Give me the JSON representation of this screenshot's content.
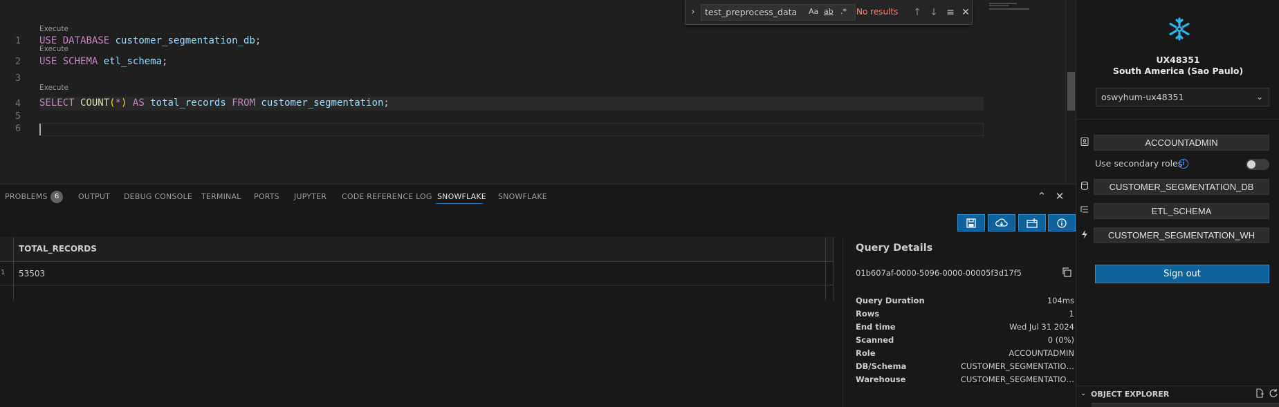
{
  "editor": {
    "codelens_label": "Execute",
    "line_numbers": [
      "1",
      "2",
      "3",
      "4",
      "5",
      "6"
    ],
    "lines": {
      "l1": {
        "kw1": "USE",
        "kw2": "DATABASE",
        "ident": "customer_segmentation_db",
        "term": ";"
      },
      "l2": {
        "kw1": "USE",
        "kw2": "SCHEMA",
        "ident": "etl_schema",
        "term": ";"
      },
      "l4": {
        "kw1": "SELECT",
        "fn": "COUNT",
        "open": "(",
        "star": "*",
        "close": ")",
        "kw2": "AS",
        "alias": "total_records",
        "kw3": "FROM",
        "table": "customer_segmentation",
        "term": ";"
      }
    }
  },
  "find_widget": {
    "query": "test_preprocess_data",
    "match_case": "Aa",
    "whole_word": "ab",
    "regex": ".*",
    "status": "No results"
  },
  "panel": {
    "tabs": [
      {
        "label": "PROBLEMS",
        "badge": "6"
      },
      {
        "label": "OUTPUT"
      },
      {
        "label": "DEBUG CONSOLE"
      },
      {
        "label": "TERMINAL"
      },
      {
        "label": "PORTS"
      },
      {
        "label": "JUPYTER"
      },
      {
        "label": "CODE REFERENCE LOG"
      },
      {
        "label": "SNOWFLAKE",
        "active": true
      },
      {
        "label": "SNOWFLAKE"
      }
    ]
  },
  "results": {
    "columns": [
      "TOTAL_RECORDS"
    ],
    "rows": [
      {
        "num": "1",
        "values": [
          "53503"
        ]
      }
    ]
  },
  "query_details": {
    "title": "Query Details",
    "query_id": "01b607af-0000-5096-0000-00005f3d17f5",
    "fields": [
      {
        "key": "Query Duration",
        "value": "104ms"
      },
      {
        "key": "Rows",
        "value": "1"
      },
      {
        "key": "End time",
        "value": "Wed Jul 31 2024"
      },
      {
        "key": "Scanned",
        "value": "0 (0%)"
      },
      {
        "key": "Role",
        "value": "ACCOUNTADMIN"
      },
      {
        "key": "DB/Schema",
        "value": "CUSTOMER_SEGMENTATIO…"
      },
      {
        "key": "Warehouse",
        "value": "CUSTOMER_SEGMENTATIO…"
      }
    ]
  },
  "sidebar": {
    "account_name": "UX48351",
    "account_region": "South America (Sao Paulo)",
    "account_select": "oswyhum-ux48351",
    "role": "ACCOUNTADMIN",
    "secondary_roles_label": "Use secondary roles",
    "secondary_roles_enabled": false,
    "database": "CUSTOMER_SEGMENTATION_DB",
    "schema": "ETL_SCHEMA",
    "warehouse": "CUSTOMER_SEGMENTATION_WH",
    "sign_out": "Sign out",
    "object_explorer": "OBJECT EXPLORER"
  },
  "colors": {
    "accent": "#0e639c",
    "find_no_results": "#f48771",
    "snowflake_logo": "#29b5e8",
    "keyword": "#c586c0",
    "identifier": "#9cdcfe"
  }
}
